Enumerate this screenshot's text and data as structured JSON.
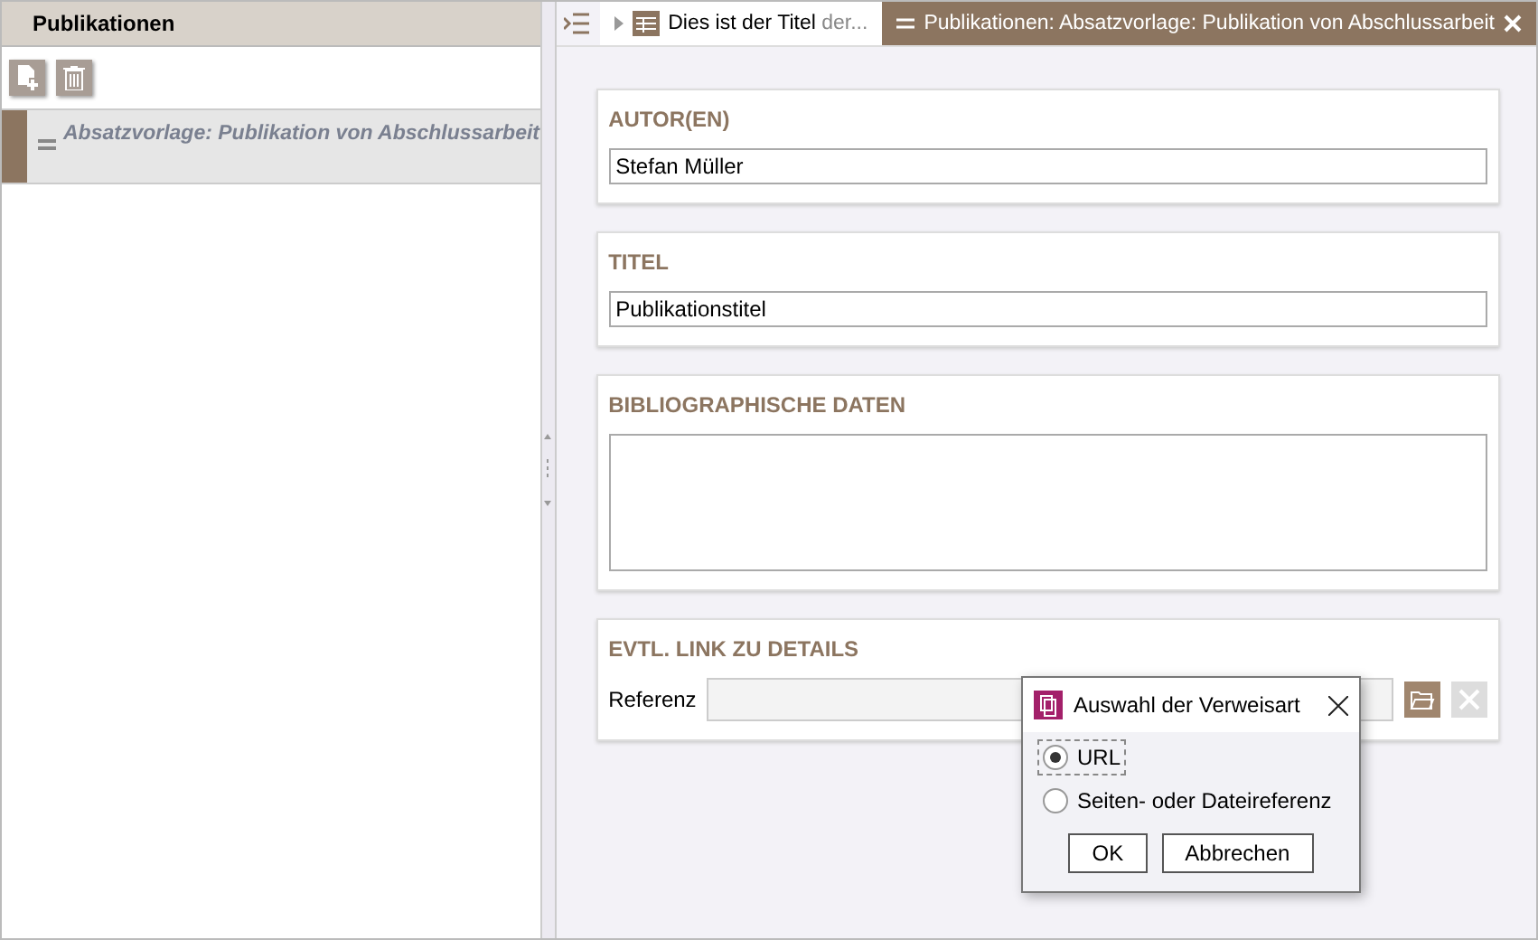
{
  "left_panel": {
    "title": "Publikationen",
    "items": [
      {
        "label": "Absatzvorlage: Publikation von Abschlussarbeit",
        "selected": true
      }
    ]
  },
  "tabs": [
    {
      "label": "Dies ist der Titel",
      "faded": "der...",
      "kind": "page",
      "selected": false
    },
    {
      "label": "Publikationen: Absatzvorlage: Publikation von Abschlussarbeit",
      "kind": "section",
      "selected": true
    }
  ],
  "sections": [
    {
      "title": "AUTOR(EN)",
      "kind": "input",
      "value": "Stefan Müller"
    },
    {
      "title": "TITEL",
      "kind": "input",
      "value": "Publikationstitel"
    },
    {
      "title": "BIBLIOGRAPHISCHE DATEN",
      "kind": "textarea"
    },
    {
      "title": "EVTL. LINK ZU DETAILS",
      "kind": "link",
      "label": "Referenz",
      "delete_disabled": true
    }
  ],
  "dialog": {
    "title": "Auswahl der Verweisart",
    "options": [
      {
        "label": "URL",
        "selected": true
      },
      {
        "label": "Seiten- oder Dateireferenz",
        "selected": false
      }
    ],
    "buttons": [
      "OK",
      "Abbrechen"
    ]
  }
}
